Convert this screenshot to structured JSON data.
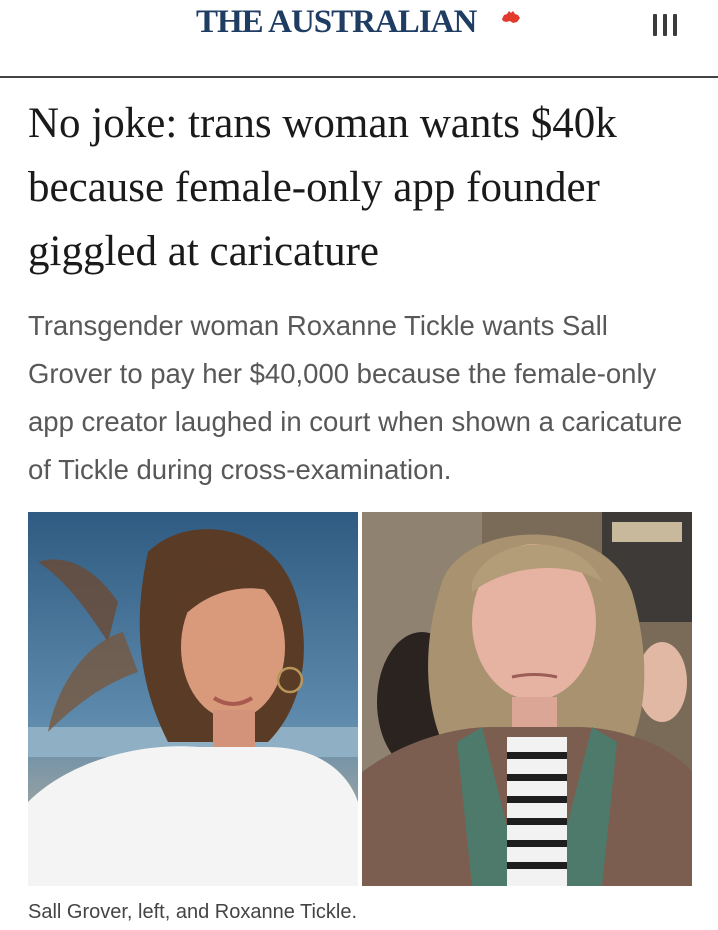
{
  "masthead": {
    "brand": "THE AUSTRALIAN",
    "brand_mark_icon": "australia-map-icon",
    "menu_icon": "menu-icon",
    "brand_color": "#1f3d63",
    "mark_color": "#e23b2e"
  },
  "article": {
    "headline": "No joke: trans woman wants $40k because female-only app founder giggled at caricature",
    "standfirst": "Transgender woman Roxanne Tickle wants Sall Grover to pay her $40,000 because the female-only app creator laughed in court when shown a caricature of Tickle during cross-examination.",
    "photo_caption": "Sall Grover, left, and Roxanne Tickle."
  }
}
